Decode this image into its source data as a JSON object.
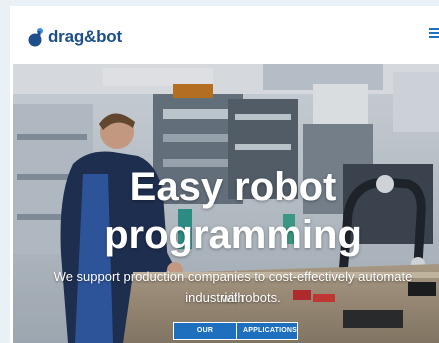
{
  "header": {
    "logo_text": "drag&bot",
    "menu_icon": "hamburger-menu-icon",
    "brand_color": "#1c4f8c",
    "accent_color": "#1d72c4"
  },
  "hero": {
    "title_line1": "Easy robot",
    "title_line2": "programming",
    "subtitle_line1": "We support production companies to cost-effectively automate with",
    "subtitle_line2": "industrial robots.",
    "buttons": [
      {
        "label": "OUR PRODUCT"
      },
      {
        "label": "APPLICATIONS"
      }
    ],
    "button_color": "#1f6fbf"
  }
}
